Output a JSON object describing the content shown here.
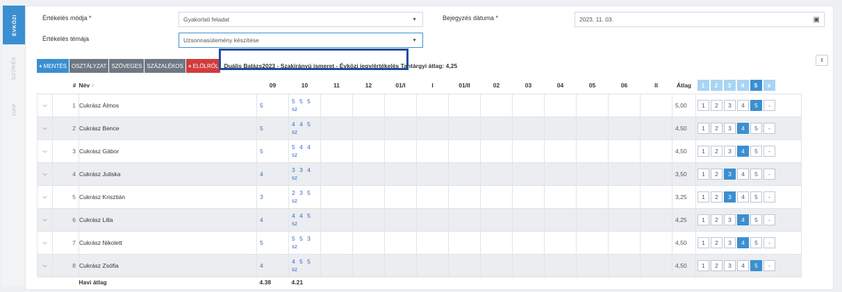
{
  "side_tabs": [
    {
      "label": "ÉVKÖZI",
      "active": true
    },
    {
      "label": "SZŰRÉS",
      "active": false
    },
    {
      "label": "TIPP",
      "active": false
    }
  ],
  "form": {
    "method_label": "Értékelés módja *",
    "method_value": "Gyakorlati feladat",
    "date_label": "Bejegyzés dátuma *",
    "date_value": "2023. 11. 03.",
    "topic_label": "Értékelés témája",
    "topic_value": "Uzsonnasütemény készítése"
  },
  "toolbar": {
    "save": "MENTÉS",
    "grade": "OSZTÁLYZAT",
    "text": "SZÖVEGES",
    "percent": "SZÁZALÉKOS",
    "from_start": "ELÖLRŐL",
    "title": "Duális Balázs2023 - Szakirányú ismeret - Évközi jegy/értékelés  Tantárgyi átlag: 4,25"
  },
  "table": {
    "headers": {
      "num": "#",
      "name": "Név",
      "sort": "↑",
      "months": [
        "09",
        "10",
        "11",
        "12",
        "01/I",
        "I",
        "01/II",
        "02",
        "03",
        "04",
        "05",
        "06",
        "II"
      ],
      "avg": "Átlag"
    },
    "header_picker": [
      "1",
      "2",
      "3",
      "4",
      "5",
      "x"
    ],
    "header_picker_selected": 4,
    "picker_labels": [
      "1",
      "2",
      "3",
      "4",
      "5",
      "-"
    ],
    "rows": [
      {
        "num": "1",
        "name": "Cukrász Álmos",
        "g09": "5",
        "g10": "5 5 5",
        "g10_note": "sz",
        "avg": "5,00",
        "selected": 4
      },
      {
        "num": "2",
        "name": "Cukrász Bence",
        "g09": "5",
        "g10": "4 4 5",
        "g10_note": "sz",
        "avg": "4,50",
        "selected": 3
      },
      {
        "num": "3",
        "name": "Cukrász Gábor",
        "g09": "5",
        "g10": "5 4 4",
        "g10_note": "sz",
        "avg": "4,50",
        "selected": 3
      },
      {
        "num": "4",
        "name": "Cukrász Juliska",
        "g09": "4",
        "g10": "3 3 4",
        "g10_note": "sz",
        "avg": "3,50",
        "selected": 2
      },
      {
        "num": "5",
        "name": "Cukrász Krisztián",
        "g09": "3",
        "g10": "2 3 5",
        "g10_note": "sz",
        "avg": "3,25",
        "selected": 2
      },
      {
        "num": "6",
        "name": "Cukrász Lilla",
        "g09": "4",
        "g10": "4 4 5",
        "g10_note": "sz",
        "avg": "4,25",
        "selected": 3
      },
      {
        "num": "7",
        "name": "Cukrász Nikolett",
        "g09": "5",
        "g10": "5 5 3",
        "g10_note": "sz",
        "avg": "4,50",
        "selected": 3
      },
      {
        "num": "8",
        "name": "Cukrász Zsófia",
        "g09": "4",
        "g10": "4 5 5",
        "g10_note": "sz",
        "avg": "4,50",
        "selected": 4
      }
    ],
    "footer": {
      "label": "Havi átlag",
      "m09": "4.38",
      "m10": "4.21"
    }
  },
  "colors": {
    "accent": "#3b8fd0",
    "danger": "#d13c3c",
    "highlight": "#1f4ea0"
  }
}
